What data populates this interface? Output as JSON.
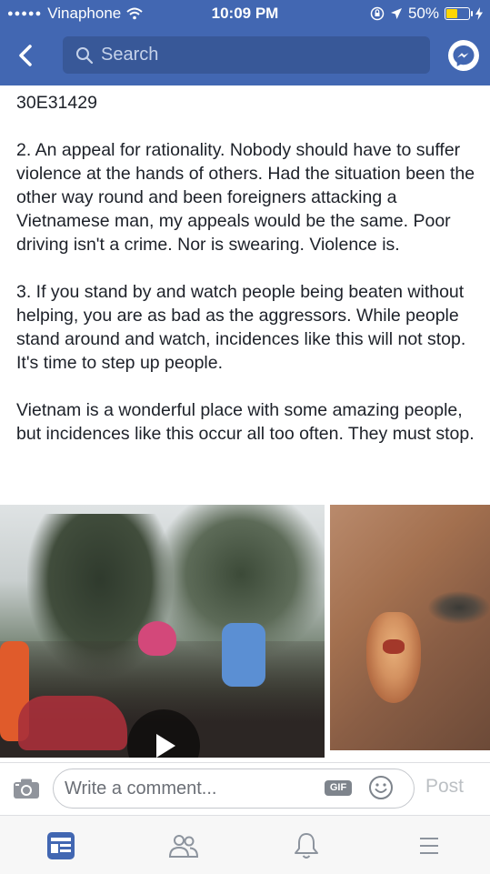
{
  "status_bar": {
    "signal_dots": "●●●●●",
    "carrier": "Vinaphone",
    "time": "10:09 PM",
    "battery": "50%",
    "battery_level": 0.5
  },
  "header": {
    "search_placeholder": "Search",
    "back_icon": "back-chevron-icon",
    "messenger_icon": "messenger-icon"
  },
  "post": {
    "paragraphs": [
      "30E31429",
      "2. An appeal for rationality. Nobody should have to suffer violence at the hands of others. Had the situation been the other way round and been foreigners attacking a Vietnamese man, my appeals would be the same. Poor driving isn't a crime. Nor is swearing. Violence is.",
      "3. If you stand by and watch people being beaten without helping, you are as bad as the aggressors. While people stand around and watch, incidences like this will not stop. It's time to step up people.",
      "Vietnam is a wonderful place with some amazing people, but incidences like this occur all too often. They must stop."
    ]
  },
  "media": {
    "left_item": "video",
    "right_item": "photo"
  },
  "comment_bar": {
    "placeholder": "Write a comment...",
    "gif_label": "GIF",
    "post_label": "Post"
  },
  "tab_bar": {
    "items": [
      "news-feed-icon",
      "friends-icon",
      "notifications-icon",
      "menu-icon"
    ]
  },
  "colors": {
    "brand_blue": "#4267b2",
    "search_bg": "#385898",
    "active_tab": "#4267b2"
  }
}
